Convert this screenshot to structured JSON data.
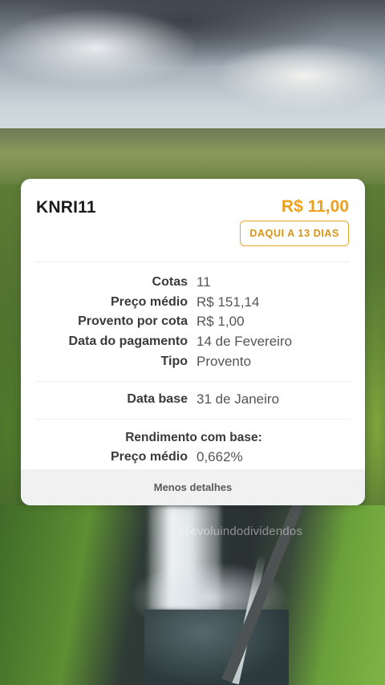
{
  "watermark": "@evoluindodividendos",
  "card": {
    "ticker": "KNRI11",
    "amount": "R$ 11,00",
    "badge": "DAQUI A 13 DIAS",
    "details": [
      {
        "label": "Cotas",
        "value": "11"
      },
      {
        "label": "Preço médio",
        "value": "R$ 151,14"
      },
      {
        "label": "Provento por cota",
        "value": "R$ 1,00"
      },
      {
        "label": "Data do pagamento",
        "value": "14 de Fevereiro"
      },
      {
        "label": "Tipo",
        "value": "Provento"
      }
    ],
    "base": {
      "label": "Data base",
      "value": "31 de Janeiro"
    },
    "rendimento": {
      "title": "Rendimento com base:",
      "label": "Preço médio",
      "value": "0,662%"
    },
    "footer_button": "Menos detalhes"
  },
  "colors": {
    "accent": "#eea01b",
    "badge_border": "#e8a72a",
    "card_bg": "#ffffff",
    "footer_bg": "#f1f1f2"
  }
}
